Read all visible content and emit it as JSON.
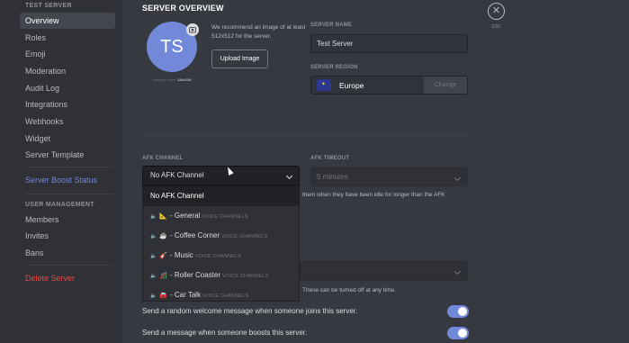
{
  "sidebar": {
    "server_header": "TEST SERVER",
    "items": [
      {
        "label": "Overview"
      },
      {
        "label": "Roles"
      },
      {
        "label": "Emoji"
      },
      {
        "label": "Moderation"
      },
      {
        "label": "Audit Log"
      },
      {
        "label": "Integrations"
      },
      {
        "label": "Webhooks"
      },
      {
        "label": "Widget"
      },
      {
        "label": "Server Template"
      }
    ],
    "boost_status": "Server Boost Status",
    "user_mgmt_header": "USER MANAGEMENT",
    "user_items": [
      {
        "label": "Members"
      },
      {
        "label": "Invites"
      },
      {
        "label": "Bans"
      }
    ],
    "delete_server": "Delete Server"
  },
  "overview": {
    "title": "SERVER OVERVIEW",
    "avatar_initials": "TS",
    "min_size_prefix": "Minimum Size:",
    "min_size_value": "128x128",
    "recommend_text": "We recommend an image of at least 512x512 for the server.",
    "upload_button": "Upload Image",
    "server_name_label": "SERVER NAME",
    "server_name_value": "Test Server",
    "server_region_label": "SERVER REGION",
    "server_region_value": "Europe",
    "change_button": "Change"
  },
  "afk": {
    "channel_label": "AFK CHANNEL",
    "channel_selected": "No AFK Channel",
    "timeout_label": "AFK TIMEOUT",
    "timeout_value": "5 minutes",
    "description_fragment": "them when they have been idle for longer than the AFK",
    "dropdown": [
      {
        "label": "No AFK Channel",
        "emoji": "",
        "category": ""
      },
      {
        "label": "- General",
        "emoji": "📐",
        "category": "VOICE CHANNELS"
      },
      {
        "label": "- Coffee Corner",
        "emoji": "☕",
        "category": "VOICE CHANNELS"
      },
      {
        "label": "- Music",
        "emoji": "🎸",
        "category": "VOICE CHANNELS"
      },
      {
        "label": "- Roller Coaster",
        "emoji": "🎢",
        "category": "VOICE CHANNELS"
      },
      {
        "label": "- Car Talk",
        "emoji": "🚘",
        "category": "VOICE CHANNELS"
      }
    ]
  },
  "notifications": {
    "hint": "These can be turned off at any time."
  },
  "toggles": [
    {
      "label": "Send a random welcome message when someone joins this server.",
      "enabled": true
    },
    {
      "label": "Send a message when someone boosts this server.",
      "enabled": true
    }
  ],
  "close": {
    "glyph": "✕",
    "esc_label": "ESC"
  },
  "colors": {
    "accent": "#7289da",
    "danger": "#f04747",
    "background": "#36393f",
    "sidebar": "#2f3136"
  },
  "icons": [
    "close-icon",
    "upload-image-icon",
    "chevron-down-icon",
    "speaker-icon",
    "eu-flag-icon"
  ]
}
